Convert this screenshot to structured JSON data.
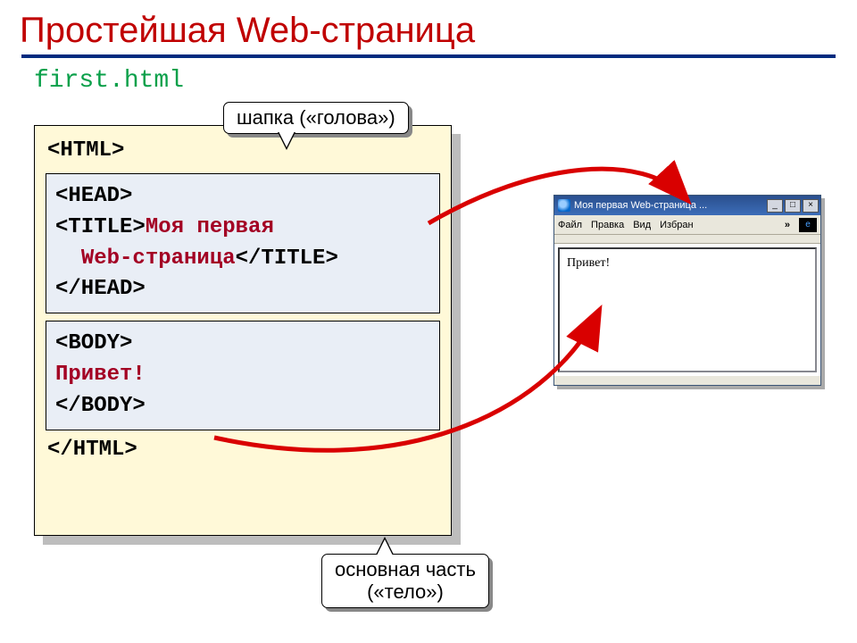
{
  "slide": {
    "title": "Простейшая Web-страница",
    "filename": "first.html"
  },
  "code": {
    "html_open": "<HTML>",
    "head_open": "<HEAD>",
    "title_open": "<TITLE>",
    "title_text_l1": "Моя первая",
    "title_text_l2": "Web-страница",
    "title_close": "</TITLE>",
    "head_close": "</HEAD>",
    "body_open": "<BODY>",
    "body_text": "Привет!",
    "body_close": "</BODY>",
    "html_close": "</HTML>"
  },
  "callouts": {
    "head": "шапка («голова»)",
    "body_l1": "основная часть",
    "body_l2": "(«тело»)"
  },
  "browser": {
    "window_title": "Моя первая Web-страница ...",
    "menu": {
      "file": "Файл",
      "edit": "Правка",
      "view": "Вид",
      "fav": "Избран"
    },
    "chevron": "»",
    "page_content": "Привет!",
    "buttons": {
      "min": "_",
      "max": "□",
      "close": "×"
    }
  }
}
